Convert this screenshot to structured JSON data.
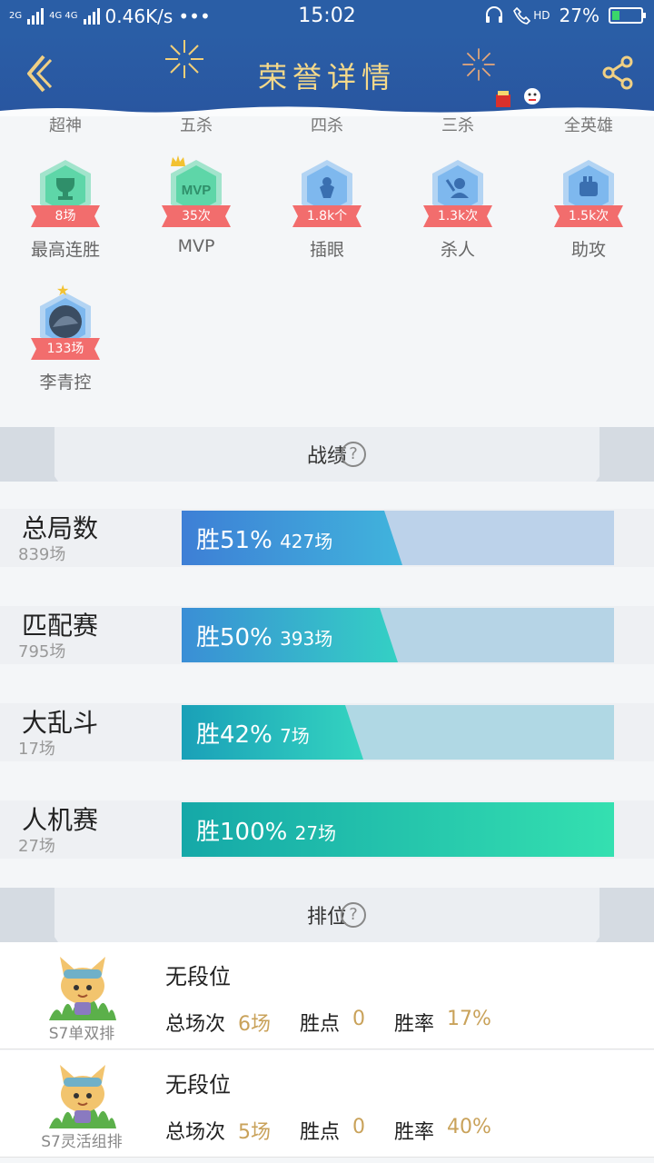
{
  "status_bar": {
    "network": "2G",
    "network2": "4G 4G",
    "speed": "0.46K/s",
    "dots": "•••",
    "time": "15:02",
    "hd": "HD",
    "battery": "27%",
    "battery_level": 0.27
  },
  "header": {
    "title": "荣誉详情"
  },
  "honor_labels": [
    "超神",
    "五杀",
    "四杀",
    "三杀",
    "全英雄"
  ],
  "badges_row1": [
    {
      "ribbon": "8场",
      "name": "最高连胜",
      "color": "#5ed6a8",
      "icon": "trophy-icon"
    },
    {
      "ribbon": "35次",
      "name": "MVP",
      "color": "#5ed6a8",
      "icon": "mvp-icon"
    },
    {
      "ribbon": "1.8k个",
      "name": "插眼",
      "color": "#7eb8ee",
      "icon": "ward-icon"
    },
    {
      "ribbon": "1.3k次",
      "name": "杀人",
      "color": "#7eb8ee",
      "icon": "kill-icon"
    },
    {
      "ribbon": "1.5k次",
      "name": "助攻",
      "color": "#7eb8ee",
      "icon": "assist-icon"
    }
  ],
  "badges_row2": [
    {
      "ribbon": "133场",
      "name": "李青控",
      "color": "#7eb8ee",
      "icon": "champion-portrait-icon"
    }
  ],
  "stats_section": {
    "title": "战绩",
    "help": "?"
  },
  "stats": [
    {
      "name": "总局数",
      "count": "839场",
      "win": "胜51%",
      "wins": "427场",
      "rate": 0.51,
      "from": "#3e7fd6",
      "to": "#40b4dc",
      "track": "#bcd2ea"
    },
    {
      "name": "匹配赛",
      "count": "795场",
      "win": "胜50%",
      "wins": "393场",
      "rate": 0.5,
      "from": "#3a8ed6",
      "to": "#34d0c4",
      "track": "#b6d4e6"
    },
    {
      "name": "大乱斗",
      "count": "17场",
      "win": "胜42%",
      "wins": "7场",
      "rate": 0.42,
      "from": "#1aa0b8",
      "to": "#34d4c0",
      "track": "#b0d8e4"
    },
    {
      "name": "人机赛",
      "count": "27场",
      "win": "胜100%",
      "wins": "27场",
      "rate": 1.0,
      "from": "#15a8a8",
      "to": "#34e0b0",
      "track": "#b0dcd8"
    }
  ],
  "rank_section": {
    "title": "排位",
    "help": "?"
  },
  "ranks": [
    {
      "season": "S7单双排",
      "tier": "无段位",
      "total_label": "总场次",
      "total": "6场",
      "lp_label": "胜点",
      "lp": "0",
      "rate_label": "胜率",
      "rate": "17%"
    },
    {
      "season": "S7灵活组排",
      "tier": "无段位",
      "total_label": "总场次",
      "total": "5场",
      "lp_label": "胜点",
      "lp": "0",
      "rate_label": "胜率",
      "rate": "40%"
    }
  ]
}
